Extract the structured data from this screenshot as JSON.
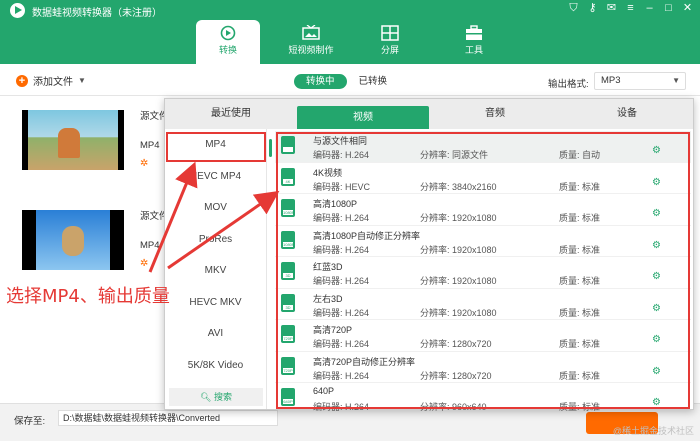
{
  "app": {
    "title": "数据蛙视频转换器（未注册）"
  },
  "nav": {
    "convert": {
      "label": "转换",
      "icon": "convert-icon"
    },
    "short_video": {
      "label": "短视频制作",
      "icon": "tv-icon"
    },
    "split_screen": {
      "label": "分屏",
      "icon": "grid-icon"
    },
    "tools": {
      "label": "工具",
      "icon": "toolbox-icon"
    }
  },
  "toolbar": {
    "add_file": "添加文件",
    "converting": "转换中",
    "converted": "已转换",
    "output_format_label": "输出格式:",
    "output_format_value": "MP3"
  },
  "files": [
    {
      "name": "源文件",
      "format": "MP4"
    },
    {
      "name": "源文件",
      "format": "MP4"
    }
  ],
  "popup": {
    "tabs": [
      "最近使用",
      "视频",
      "音频",
      "设备"
    ],
    "active_tab": "视频",
    "formats": [
      "MP4",
      "HEVC MP4",
      "MOV",
      "ProRes",
      "MKV",
      "HEVC MKV",
      "AVI",
      "5K/8K Video"
    ],
    "search_label": "搜索",
    "presets": [
      {
        "name": "与源文件相同",
        "codec": "编码器: H.264",
        "res": "分辨率: 同源文件",
        "quality": "质量: 自动",
        "badge": ""
      },
      {
        "name": "4K视频",
        "codec": "编码器: HEVC",
        "res": "分辨率: 3840x2160",
        "quality": "质量: 标准",
        "badge": "4K"
      },
      {
        "name": "高清1080P",
        "codec": "编码器: H.264",
        "res": "分辨率: 1920x1080",
        "quality": "质量: 标准",
        "badge": "1080P"
      },
      {
        "name": "高清1080P自动修正分辨率",
        "codec": "编码器: H.264",
        "res": "分辨率: 1920x1080",
        "quality": "质量: 标准",
        "badge": "1080P"
      },
      {
        "name": "红蓝3D",
        "codec": "编码器: H.264",
        "res": "分辨率: 1920x1080",
        "quality": "质量: 标准",
        "badge": "3D"
      },
      {
        "name": "左右3D",
        "codec": "编码器: H.264",
        "res": "分辨率: 1920x1080",
        "quality": "质量: 标准",
        "badge": "3D"
      },
      {
        "name": "高清720P",
        "codec": "编码器: H.264",
        "res": "分辨率: 1280x720",
        "quality": "质量: 标准",
        "badge": "720P"
      },
      {
        "name": "高清720P自动修正分辨率",
        "codec": "编码器: H.264",
        "res": "分辨率: 1280x720",
        "quality": "质量: 标准",
        "badge": "720P"
      },
      {
        "name": "640P",
        "codec": "编码器: H.264",
        "res": "分辨率: 960x640",
        "quality": "质量: 标准",
        "badge": "640P"
      }
    ]
  },
  "bottom": {
    "save_to_label": "保存至:",
    "save_path": "D:\\数据蛙\\数据蛙视频转换器\\Converted"
  },
  "annotation": {
    "text": "选择MP4、输出质量",
    "color": "#e53935"
  },
  "watermark": "@稀土掘金技术社区",
  "colors": {
    "brand": "#23a66d",
    "accent": "#ff6a00"
  }
}
